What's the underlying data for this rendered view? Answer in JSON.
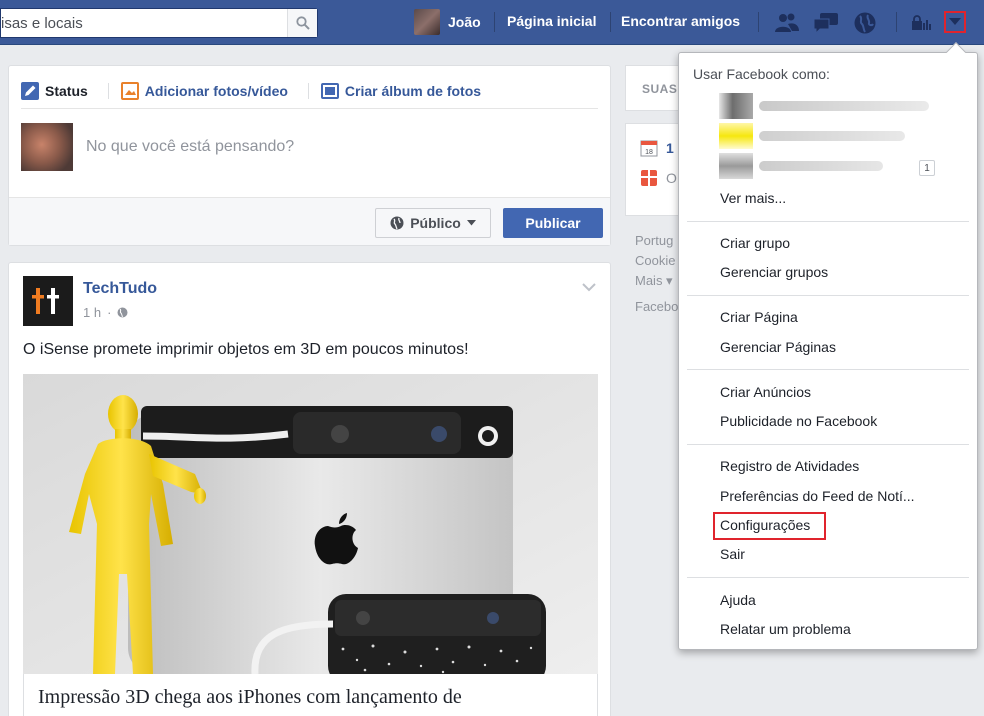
{
  "topbar": {
    "search_text": "isas e locais",
    "profile_name": "João",
    "home_label": "Página inicial",
    "find_friends_label": "Encontrar amigos",
    "brand_color": "#3b5998",
    "icons": [
      "friend-requests-icon",
      "messages-icon",
      "notifications-globe-icon",
      "privacy-lock-icon",
      "account-dropdown-icon"
    ]
  },
  "composer": {
    "tabs": [
      {
        "label": "Status",
        "icon": "pencil-icon"
      },
      {
        "label": "Adicionar fotos/vídeo",
        "icon": "photo-icon"
      },
      {
        "label": "Criar álbum de fotos",
        "icon": "album-icon"
      }
    ],
    "placeholder": "No que você está pensando?",
    "audience_label": "Público",
    "publish_label": "Publicar"
  },
  "post": {
    "author": "TechTudo",
    "time": "1 h",
    "text": "O iSense promete imprimir objetos em 3D em poucos minutos!",
    "link_title": "Impressão 3D chega aos iPhones com lançamento de"
  },
  "sidebar": {
    "card_title": "SUAS",
    "events_count": "1",
    "events_prefix": "O",
    "footer": [
      "Portug",
      "Cookie",
      "Mais ▾",
      "Facebo"
    ]
  },
  "menu": {
    "header": "Usar Facebook como:",
    "accounts_badge": "1",
    "see_more": "Ver mais...",
    "groups": [
      "Criar grupo",
      "Gerenciar grupos"
    ],
    "pages": [
      "Criar Página",
      "Gerenciar Páginas"
    ],
    "ads": [
      "Criar Anúncios",
      "Publicidade no Facebook"
    ],
    "settings": [
      "Registro de Atividades",
      "Preferências do Feed de Notí...",
      "Configurações",
      "Sair"
    ],
    "help": [
      "Ajuda",
      "Relatar um problema"
    ],
    "highlight_color": "#e0242d"
  }
}
